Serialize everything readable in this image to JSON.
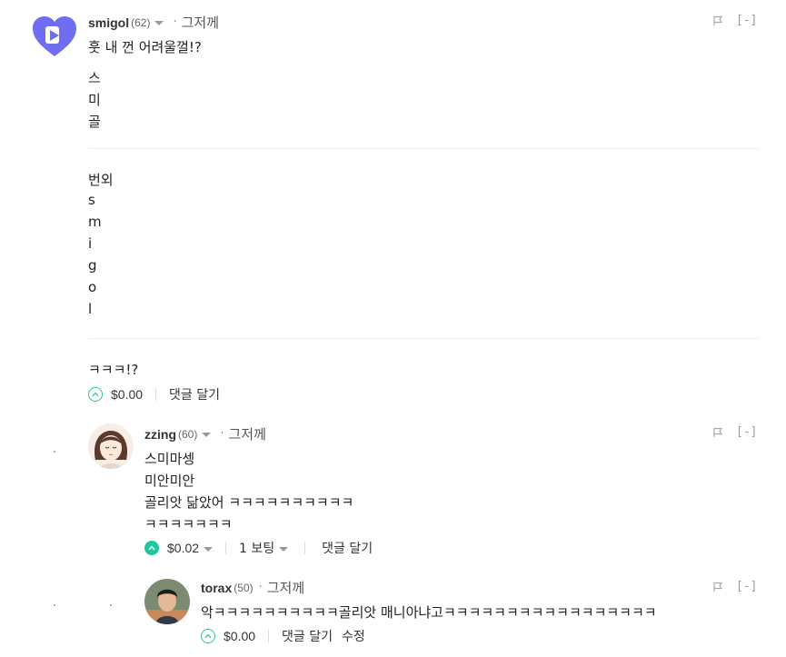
{
  "comments": [
    {
      "author": "smigol",
      "reputation": "(62)",
      "separator": "·",
      "time": "그저께",
      "collapse": "[-]",
      "body": [
        "훗 내 껀 어려울껄!?",
        "스",
        "미",
        "골",
        "번외",
        "s",
        "m",
        "i",
        "g",
        "o",
        "l",
        "ㅋㅋㅋ!?"
      ],
      "payout": "$0.00",
      "reply": "댓글 달기"
    },
    {
      "author": "zzing",
      "reputation": "(60)",
      "separator": "·",
      "time": "그저께",
      "collapse": "[-]",
      "body": [
        "스미마셍",
        "미안미안",
        "골리앗 닮았어 ㅋㅋㅋㅋㅋㅋㅋㅋㅋㅋ",
        "ㅋㅋㅋㅋㅋㅋㅋ"
      ],
      "payout": "$0.02",
      "votes": "1 보팅",
      "reply": "댓글 달기"
    },
    {
      "author": "torax",
      "reputation": "(50)",
      "separator": "·",
      "time": "그저께",
      "collapse": "[-]",
      "body": [
        "악ㅋㅋㅋㅋㅋㅋㅋㅋㅋㅋ골리앗 매니아냐고ㅋㅋㅋㅋㅋㅋㅋㅋㅋㅋㅋㅋㅋㅋㅋㅋㅋ"
      ],
      "payout": "$0.00",
      "reply": "댓글 달기",
      "edit": "수정"
    }
  ],
  "colors": {
    "accent": "#1cc99e",
    "logo": "#6f6df0"
  },
  "icons": [
    "heart-play-logo",
    "flag-icon",
    "upvote-icon",
    "chevron-down-icon"
  ]
}
